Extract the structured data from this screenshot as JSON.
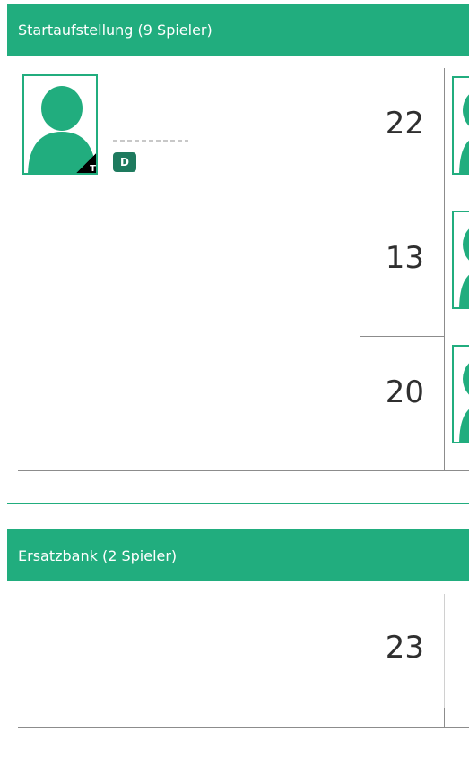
{
  "lineup": {
    "title": "Startaufstellung (9 Spieler)",
    "player": {
      "badge": "D",
      "corner_label": "T"
    },
    "numbers": [
      "22",
      "13",
      "20"
    ]
  },
  "bench": {
    "title": "Ersatzbank (2 Spieler)",
    "numbers": [
      "23"
    ]
  },
  "colors": {
    "accent": "#21ad7e",
    "badge": "#1e7a5e",
    "text": "#2f2f2f"
  },
  "icons": {
    "avatar": "person-silhouette-icon"
  }
}
